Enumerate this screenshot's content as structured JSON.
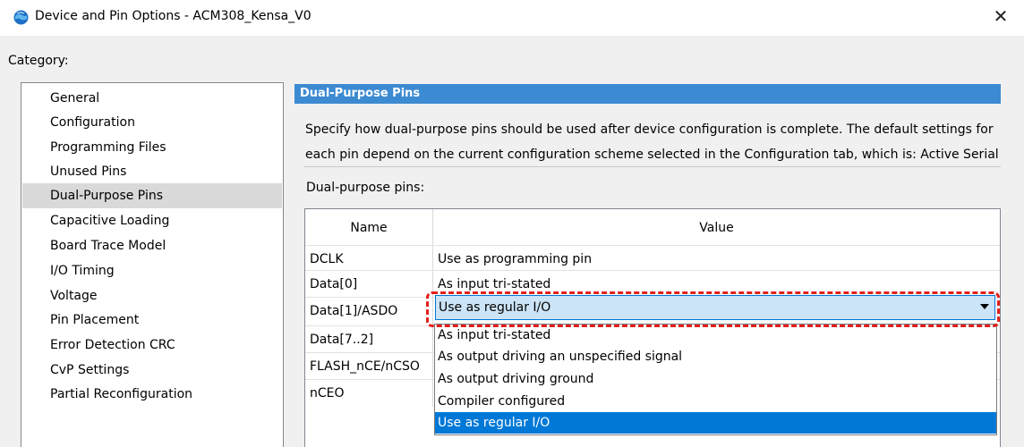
{
  "window": {
    "title": "Device and Pin Options - ACM308_Kensa_V0",
    "icon": "globe-icon",
    "close_glyph": "✕"
  },
  "category_label": "Category:",
  "sidebar": {
    "items": [
      {
        "label": "General"
      },
      {
        "label": "Configuration"
      },
      {
        "label": "Programming Files"
      },
      {
        "label": "Unused Pins"
      },
      {
        "label": "Dual-Purpose Pins",
        "selected": true
      },
      {
        "label": "Capacitive Loading"
      },
      {
        "label": "Board Trace Model"
      },
      {
        "label": "I/O Timing"
      },
      {
        "label": "Voltage"
      },
      {
        "label": "Pin Placement"
      },
      {
        "label": "Error Detection CRC"
      },
      {
        "label": "CvP Settings"
      },
      {
        "label": "Partial Reconfiguration"
      }
    ]
  },
  "panel": {
    "header": "Dual-Purpose Pins",
    "description_line1": "Specify how dual-purpose pins should be used after device configuration is complete. The default settings for",
    "description_line2": "each pin depend on the current configuration scheme selected in the Configuration tab, which is:  Active Serial",
    "pins_label": "Dual-purpose pins:"
  },
  "table": {
    "columns": [
      "Name",
      "Value"
    ],
    "rows": [
      {
        "name": "DCLK",
        "value": "Use as programming pin"
      },
      {
        "name": "Data[0]",
        "value": "As input tri-stated"
      },
      {
        "name": "Data[1]/ASDO",
        "value": "Use as regular I/O"
      },
      {
        "name": "Data[7..2]",
        "value": ""
      },
      {
        "name": "FLASH_nCE/nCSO",
        "value": ""
      },
      {
        "name": "nCEO",
        "value": ""
      }
    ]
  },
  "combo": {
    "value": "Use as regular I/O",
    "options": [
      "As input tri-stated",
      "As output driving an unspecified signal",
      "As output driving ground",
      "Compiler configured",
      "Use as regular I/O"
    ],
    "selected_index": 4
  },
  "colors": {
    "header_bg": "#3c8ad1",
    "selection_blue": "#0078d7",
    "highlight_red": "#e1201c"
  }
}
